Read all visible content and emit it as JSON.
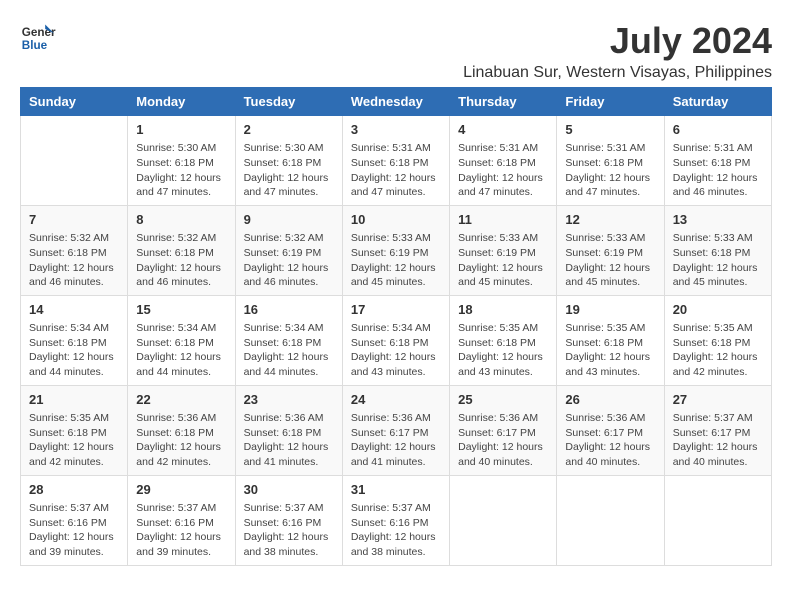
{
  "logo": {
    "line1": "General",
    "line2": "Blue"
  },
  "title": "July 2024",
  "subtitle": "Linabuan Sur, Western Visayas, Philippines",
  "days": [
    "Sunday",
    "Monday",
    "Tuesday",
    "Wednesday",
    "Thursday",
    "Friday",
    "Saturday"
  ],
  "weeks": [
    [
      {
        "day": "",
        "content": ""
      },
      {
        "day": "1",
        "content": "Sunrise: 5:30 AM\nSunset: 6:18 PM\nDaylight: 12 hours\nand 47 minutes."
      },
      {
        "day": "2",
        "content": "Sunrise: 5:30 AM\nSunset: 6:18 PM\nDaylight: 12 hours\nand 47 minutes."
      },
      {
        "day": "3",
        "content": "Sunrise: 5:31 AM\nSunset: 6:18 PM\nDaylight: 12 hours\nand 47 minutes."
      },
      {
        "day": "4",
        "content": "Sunrise: 5:31 AM\nSunset: 6:18 PM\nDaylight: 12 hours\nand 47 minutes."
      },
      {
        "day": "5",
        "content": "Sunrise: 5:31 AM\nSunset: 6:18 PM\nDaylight: 12 hours\nand 47 minutes."
      },
      {
        "day": "6",
        "content": "Sunrise: 5:31 AM\nSunset: 6:18 PM\nDaylight: 12 hours\nand 46 minutes."
      }
    ],
    [
      {
        "day": "7",
        "content": "Sunrise: 5:32 AM\nSunset: 6:18 PM\nDaylight: 12 hours\nand 46 minutes."
      },
      {
        "day": "8",
        "content": "Sunrise: 5:32 AM\nSunset: 6:18 PM\nDaylight: 12 hours\nand 46 minutes."
      },
      {
        "day": "9",
        "content": "Sunrise: 5:32 AM\nSunset: 6:19 PM\nDaylight: 12 hours\nand 46 minutes."
      },
      {
        "day": "10",
        "content": "Sunrise: 5:33 AM\nSunset: 6:19 PM\nDaylight: 12 hours\nand 45 minutes."
      },
      {
        "day": "11",
        "content": "Sunrise: 5:33 AM\nSunset: 6:19 PM\nDaylight: 12 hours\nand 45 minutes."
      },
      {
        "day": "12",
        "content": "Sunrise: 5:33 AM\nSunset: 6:19 PM\nDaylight: 12 hours\nand 45 minutes."
      },
      {
        "day": "13",
        "content": "Sunrise: 5:33 AM\nSunset: 6:18 PM\nDaylight: 12 hours\nand 45 minutes."
      }
    ],
    [
      {
        "day": "14",
        "content": "Sunrise: 5:34 AM\nSunset: 6:18 PM\nDaylight: 12 hours\nand 44 minutes."
      },
      {
        "day": "15",
        "content": "Sunrise: 5:34 AM\nSunset: 6:18 PM\nDaylight: 12 hours\nand 44 minutes."
      },
      {
        "day": "16",
        "content": "Sunrise: 5:34 AM\nSunset: 6:18 PM\nDaylight: 12 hours\nand 44 minutes."
      },
      {
        "day": "17",
        "content": "Sunrise: 5:34 AM\nSunset: 6:18 PM\nDaylight: 12 hours\nand 43 minutes."
      },
      {
        "day": "18",
        "content": "Sunrise: 5:35 AM\nSunset: 6:18 PM\nDaylight: 12 hours\nand 43 minutes."
      },
      {
        "day": "19",
        "content": "Sunrise: 5:35 AM\nSunset: 6:18 PM\nDaylight: 12 hours\nand 43 minutes."
      },
      {
        "day": "20",
        "content": "Sunrise: 5:35 AM\nSunset: 6:18 PM\nDaylight: 12 hours\nand 42 minutes."
      }
    ],
    [
      {
        "day": "21",
        "content": "Sunrise: 5:35 AM\nSunset: 6:18 PM\nDaylight: 12 hours\nand 42 minutes."
      },
      {
        "day": "22",
        "content": "Sunrise: 5:36 AM\nSunset: 6:18 PM\nDaylight: 12 hours\nand 42 minutes."
      },
      {
        "day": "23",
        "content": "Sunrise: 5:36 AM\nSunset: 6:18 PM\nDaylight: 12 hours\nand 41 minutes."
      },
      {
        "day": "24",
        "content": "Sunrise: 5:36 AM\nSunset: 6:17 PM\nDaylight: 12 hours\nand 41 minutes."
      },
      {
        "day": "25",
        "content": "Sunrise: 5:36 AM\nSunset: 6:17 PM\nDaylight: 12 hours\nand 40 minutes."
      },
      {
        "day": "26",
        "content": "Sunrise: 5:36 AM\nSunset: 6:17 PM\nDaylight: 12 hours\nand 40 minutes."
      },
      {
        "day": "27",
        "content": "Sunrise: 5:37 AM\nSunset: 6:17 PM\nDaylight: 12 hours\nand 40 minutes."
      }
    ],
    [
      {
        "day": "28",
        "content": "Sunrise: 5:37 AM\nSunset: 6:16 PM\nDaylight: 12 hours\nand 39 minutes."
      },
      {
        "day": "29",
        "content": "Sunrise: 5:37 AM\nSunset: 6:16 PM\nDaylight: 12 hours\nand 39 minutes."
      },
      {
        "day": "30",
        "content": "Sunrise: 5:37 AM\nSunset: 6:16 PM\nDaylight: 12 hours\nand 38 minutes."
      },
      {
        "day": "31",
        "content": "Sunrise: 5:37 AM\nSunset: 6:16 PM\nDaylight: 12 hours\nand 38 minutes."
      },
      {
        "day": "",
        "content": ""
      },
      {
        "day": "",
        "content": ""
      },
      {
        "day": "",
        "content": ""
      }
    ]
  ]
}
